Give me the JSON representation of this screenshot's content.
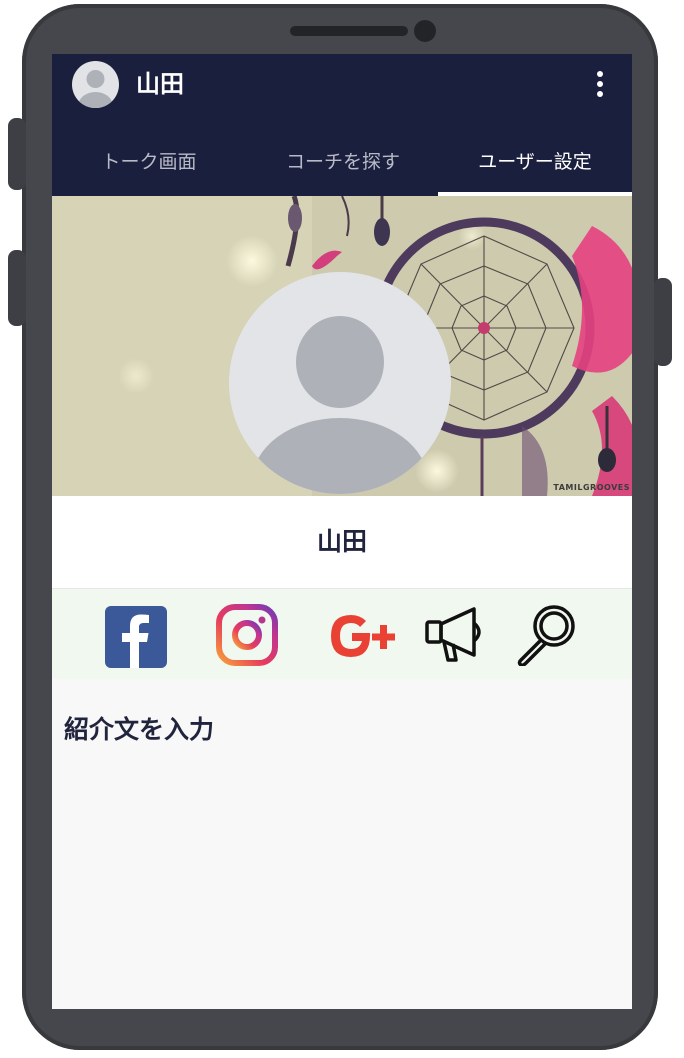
{
  "header": {
    "title": "山田",
    "avatar_icon": "default-avatar-icon",
    "menu_icon": "more-vertical-icon"
  },
  "tabs": [
    {
      "label": "トーク画面",
      "active": false
    },
    {
      "label": "コーチを探す",
      "active": false
    },
    {
      "label": "ユーザー設定",
      "active": true
    }
  ],
  "profile": {
    "name": "山田",
    "cover_watermark": "TAMILGROOVES",
    "avatar_icon": "default-avatar-icon"
  },
  "social_links": [
    {
      "name": "facebook",
      "icon": "facebook-icon"
    },
    {
      "name": "instagram",
      "icon": "instagram-icon"
    },
    {
      "name": "google-plus",
      "icon": "google-plus-icon"
    },
    {
      "name": "announce",
      "icon": "megaphone-icon"
    },
    {
      "name": "search",
      "icon": "magnifier-icon"
    }
  ],
  "intro": {
    "placeholder": "紹介文を入力"
  },
  "colors": {
    "header_bg": "#1b1f3e",
    "social_bar_bg": "#f1f8ef",
    "facebook": "#3b5998",
    "google_plus": "#e94235",
    "text_dark": "#20243c"
  }
}
